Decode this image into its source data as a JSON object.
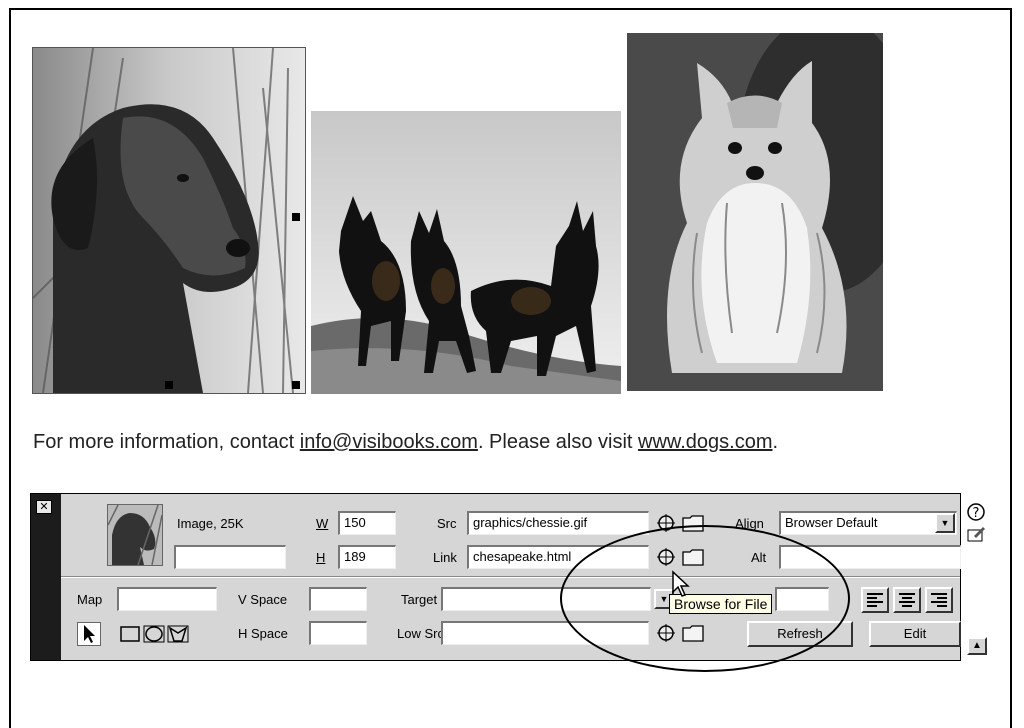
{
  "info_line": {
    "prefix": "For more information, contact ",
    "email": "info@visibooks.com",
    "middle": ". Please also visit ",
    "site": "www.dogs.com",
    "suffix": "."
  },
  "inspector": {
    "close_glyph": "✕",
    "image_label": "Image, 25K",
    "image_name_value": "",
    "w_label": "W",
    "w_value": "150",
    "h_label": "H",
    "h_value": "189",
    "src_label": "Src",
    "src_value": "graphics/chessie.gif",
    "link_label": "Link",
    "link_value": "chesapeake.html",
    "align_label": "Align",
    "align_value": "Browser Default",
    "alt_label": "Alt",
    "alt_value": "",
    "map_label": "Map",
    "map_value": "",
    "vspace_label": "V Space",
    "vspace_value": "",
    "hspace_label": "H Space",
    "hspace_value": "",
    "target_label": "Target",
    "target_value": "",
    "border_value": "",
    "lowsrc_label": "Low Src",
    "lowsrc_value": "",
    "refresh_label": "Refresh",
    "edit_label": "Edit",
    "help_glyph": "?",
    "expand_glyph": "▲"
  },
  "tooltip": "Browse for File",
  "icons": [
    "close-icon",
    "point-to-file-icon",
    "folder-icon",
    "pointer-tool-icon",
    "rect-hotspot-icon",
    "oval-hotspot-icon",
    "polygon-hotspot-icon",
    "align-left-icon",
    "align-center-icon",
    "align-right-icon",
    "help-icon",
    "quick-tag-editor-icon",
    "expander-icon",
    "dropdown-arrow-icon",
    "mouse-cursor-icon"
  ]
}
